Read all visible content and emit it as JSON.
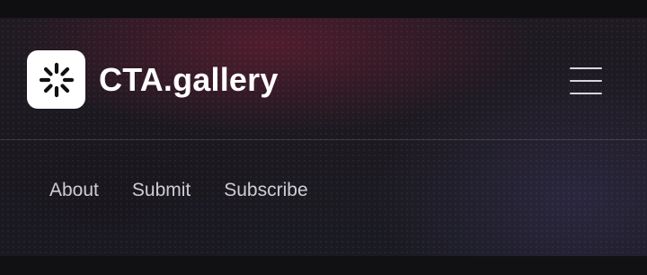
{
  "header": {
    "logo": {
      "icon": "sparkle-burst-icon",
      "text": "CTA.gallery"
    },
    "menu_icon": "hamburger-menu-icon"
  },
  "nav": {
    "items": [
      {
        "label": "About"
      },
      {
        "label": "Submit"
      },
      {
        "label": "Subscribe"
      }
    ]
  },
  "colors": {
    "background": "#131317",
    "text": "#ffffff",
    "nav_text": "#cfcdd4",
    "accent_glow": "#781e37"
  }
}
